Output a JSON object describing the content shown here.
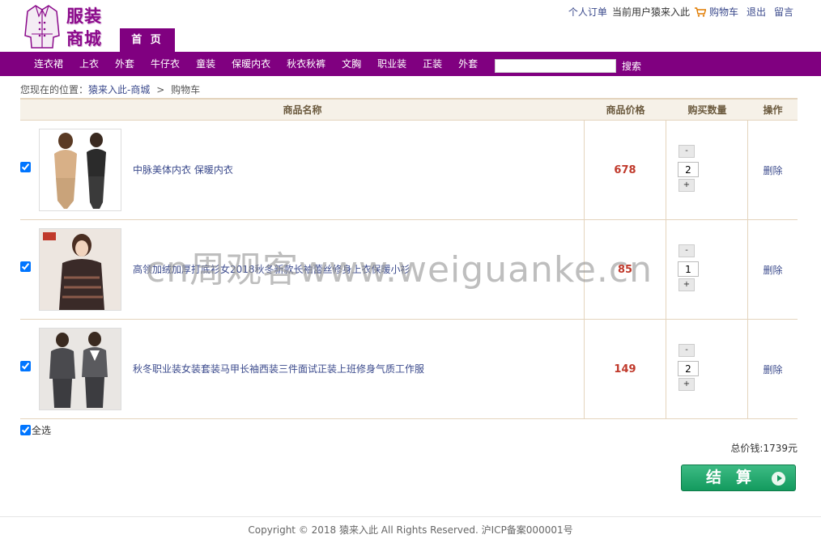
{
  "header": {
    "logo_line1": "服装",
    "logo_line2": "商城",
    "home_tab": "首 页",
    "top_links": {
      "orders": "个人订单",
      "current_user": "当前用户猿来入此",
      "cart": "购物车",
      "logout": "退出",
      "message": "留言"
    }
  },
  "nav": {
    "items": [
      "连衣裙",
      "上衣",
      "外套",
      "牛仔衣",
      "童装",
      "保暖内衣",
      "秋衣秋裤",
      "文胸",
      "职业装",
      "正装",
      "外套"
    ],
    "search_value": "",
    "search_button": "搜索"
  },
  "breadcrumb": {
    "prefix": "您现在的位置：",
    "home": "猿来入此-商城",
    "separator": ">",
    "current": "购物车"
  },
  "cart": {
    "headers": {
      "name": "商品名称",
      "price": "商品价格",
      "qty": "购买数量",
      "op": "操作"
    },
    "rows": [
      {
        "name": "中脉美体内衣 保暖内衣",
        "price": "678",
        "qty": "2",
        "checked": true,
        "minus": "-",
        "plus": "+",
        "delete": "删除"
      },
      {
        "name": "高领加绒加厚打底衫女2018秋冬新款长袖蕾丝修身上衣保暖小衫",
        "price": "85",
        "qty": "1",
        "checked": true,
        "minus": "-",
        "plus": "+",
        "delete": "删除"
      },
      {
        "name": "秋冬职业装女装套装马甲长袖西装三件面试正装上班修身气质工作服",
        "price": "149",
        "qty": "2",
        "checked": true,
        "minus": "-",
        "plus": "+",
        "delete": "删除"
      }
    ],
    "select_all": "全选",
    "total": "总价钱:1739元",
    "checkout": "结算"
  },
  "watermark": "cn周观客www.weiguanke.cn",
  "footer": "Copyright © 2018 猿来入此 All Rights Reserved. 沪ICP备案000001号",
  "colors": {
    "brand": "#800080",
    "price": "#c0392b",
    "checkout": "#139a5e",
    "link": "#3b4a8c"
  }
}
